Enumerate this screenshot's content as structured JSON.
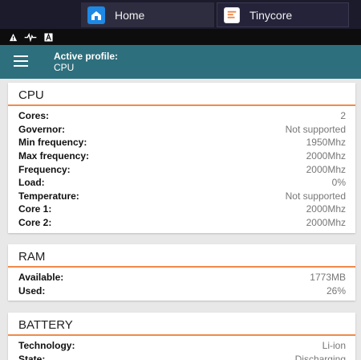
{
  "window_tabs": [
    {
      "label": "Home",
      "icon": "home-app-icon"
    },
    {
      "label": "Tinycore",
      "icon": "tinycore-app-icon"
    }
  ],
  "status_icons": [
    "warning-icon",
    "pulse-icon",
    "font-icon"
  ],
  "header": {
    "menu_icon": "hamburger-menu-icon",
    "profile_label": "Active profile:",
    "profile_value": "CPU"
  },
  "cpu": {
    "title": "CPU",
    "rows": [
      {
        "key": "Cores:",
        "value": "2"
      },
      {
        "key": "Governor:",
        "value": "Not supported"
      },
      {
        "key": "Min frequency:",
        "value": "1950Mhz"
      },
      {
        "key": "Max frequency:",
        "value": "2000Mhz"
      },
      {
        "key": "Frequency:",
        "value": "2000Mhz"
      },
      {
        "key": "Load:",
        "value": "0%"
      },
      {
        "key": "Temperature:",
        "value": "Not supported"
      },
      {
        "key": "Core 1:",
        "value": "2000Mhz"
      },
      {
        "key": "Core 2:",
        "value": "2000Mhz"
      }
    ]
  },
  "ram": {
    "title": "RAM",
    "rows": [
      {
        "key": "Available:",
        "value": "1773MB"
      },
      {
        "key": "Used:",
        "value": "26%"
      }
    ]
  },
  "battery": {
    "title": "BATTERY",
    "rows": [
      {
        "key": "Technology:",
        "value": "Li-ion"
      },
      {
        "key": "State:",
        "value": "Discharging"
      }
    ]
  },
  "colors": {
    "header_teal": "#2e6f7d",
    "accent_orange": "#f08a4b",
    "tab_bar": "#1b1b2b"
  }
}
